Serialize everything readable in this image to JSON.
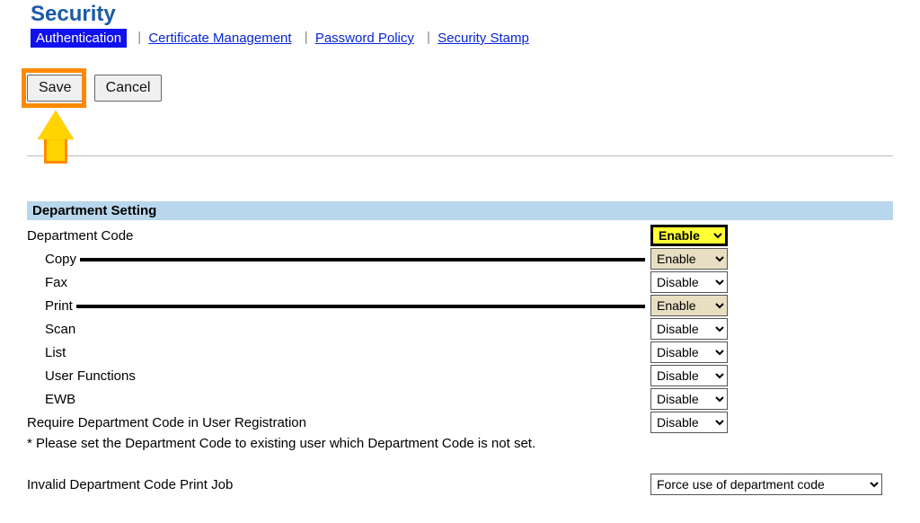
{
  "title": "Security",
  "tabs": {
    "active": "Authentication",
    "items": [
      "Certificate Management",
      "Password Policy",
      "Security Stamp"
    ]
  },
  "actions": {
    "save": "Save",
    "cancel": "Cancel"
  },
  "section_header": "Department Setting",
  "rows": {
    "department_code": {
      "label": "Department Code",
      "value": "Enable"
    },
    "copy": {
      "label": "Copy",
      "value": "Enable"
    },
    "fax": {
      "label": "Fax",
      "value": "Disable"
    },
    "print": {
      "label": "Print",
      "value": "Enable"
    },
    "scan": {
      "label": "Scan",
      "value": "Disable"
    },
    "list": {
      "label": "List",
      "value": "Disable"
    },
    "user_functions": {
      "label": "User Functions",
      "value": "Disable"
    },
    "ewb": {
      "label": "EWB",
      "value": "Disable"
    },
    "require_code": {
      "label": "Require Department Code in User Registration",
      "value": "Disable"
    }
  },
  "note": "* Please set the Department Code to existing user which Department Code is not set.",
  "invalid_job": {
    "label": "Invalid Department Code Print Job",
    "value": "Force use of department code"
  },
  "select_options": {
    "enable_disable": [
      "Enable",
      "Disable"
    ],
    "invalid_job": [
      "Force use of department code"
    ]
  }
}
